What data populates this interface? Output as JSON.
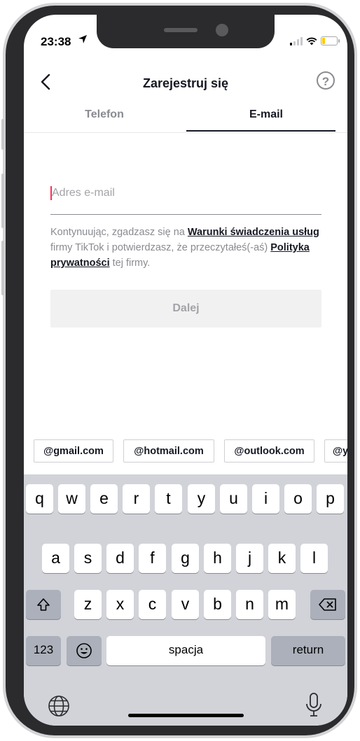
{
  "status": {
    "time": "23:38"
  },
  "header": {
    "title": "Zarejestruj się",
    "help": "?"
  },
  "tabs": [
    {
      "label": "Telefon"
    },
    {
      "label": "E-mail"
    }
  ],
  "form": {
    "email_placeholder": "Adres e-mail",
    "email_value": "",
    "terms": {
      "t1": "Kontynuując, zgadzasz się na ",
      "link1": "Warunki świadczenia usług",
      "t2": " firmy TikTok i potwierdzasz, że przeczytałeś(-aś) ",
      "link2": "Polityka prywatności",
      "t3": " tej firmy."
    },
    "next_label": "Dalej"
  },
  "suggestions": [
    "@gmail.com",
    "@hotmail.com",
    "@outlook.com",
    "@y"
  ],
  "keyboard": {
    "row1": [
      "q",
      "w",
      "e",
      "r",
      "t",
      "y",
      "u",
      "i",
      "o",
      "p"
    ],
    "row2": [
      "a",
      "s",
      "d",
      "f",
      "g",
      "h",
      "j",
      "k",
      "l"
    ],
    "row3": [
      "z",
      "x",
      "c",
      "v",
      "b",
      "n",
      "m"
    ],
    "numbers": "123",
    "space": "spacja",
    "return": "return"
  },
  "colors": {
    "accent": "#fe2c55",
    "text": "#161823",
    "muted": "#8a8b91"
  }
}
